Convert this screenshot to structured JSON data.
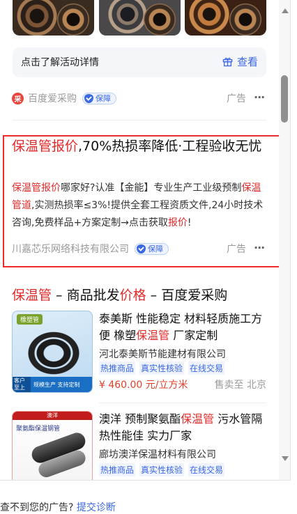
{
  "thumbnails": [
    "pipe-image",
    "pipe-image",
    "pipe-image"
  ],
  "activity": {
    "text": "点击了解活动详情",
    "button": "查看"
  },
  "ad1": {
    "source": "百度爱采购",
    "badge": "保障",
    "ad_label": "广告",
    "more": "···"
  },
  "ad2": {
    "title_hl": "保温管报价",
    "title_rest": ",70%热损率降低·工程验收无忧",
    "desc": [
      {
        "t": "保温管报价",
        "hl": true
      },
      {
        "t": "哪家好?认准【金能】专业生产工业级预制",
        "hl": false
      },
      {
        "t": "保温管道",
        "hl": true
      },
      {
        "t": ",实测热损率≤3%!提供全套工程资质文件,24小时技术咨询,免费样品+方案定制→点击获取",
        "hl": false
      },
      {
        "t": "报价",
        "hl": true
      },
      {
        "t": "!",
        "hl": false
      }
    ],
    "source": "川嘉芯乐网络科技有限公司",
    "badge": "保障",
    "ad_label": "广告",
    "more": "···"
  },
  "section": {
    "title_hl1": "保温管",
    "title_mid": " – 商品批发",
    "title_hl2": "价格",
    "title_end": " – 百度爱采购"
  },
  "products": [
    {
      "title_pre": "泰美斯 性能稳定 材料轻质施工方便 橡塑",
      "title_hl": "保温管",
      "title_post": " 厂家定制",
      "company": "河北泰美斯节能建材有限公司",
      "tags": [
        "热推商品",
        "真实性核验",
        "在线交易"
      ],
      "price": "¥ 460.00 元/立方米",
      "seller": "售卖至 北京",
      "img_tag": "橡塑管",
      "img_foot_left": "客户至上",
      "img_foot": "规模生产 支持定制"
    },
    {
      "title_pre": "澳洋 预制聚氨酯",
      "title_hl": "保温管",
      "title_post": " 污水管隔热性能佳 实力厂家",
      "company": "廊坊澳洋保温材料有限公司",
      "tags": [
        "热推商品",
        "真实性核验",
        "在线交易"
      ],
      "img_header": "澳洋",
      "img_sub": "聚氨酯保温钢管"
    }
  ],
  "footer": {
    "text": "查不到您的广告?",
    "link": "提交诊断"
  },
  "colors": {
    "accent": "#3b68e4",
    "highlight": "#e32a2a",
    "box": "#ee2a2a"
  }
}
